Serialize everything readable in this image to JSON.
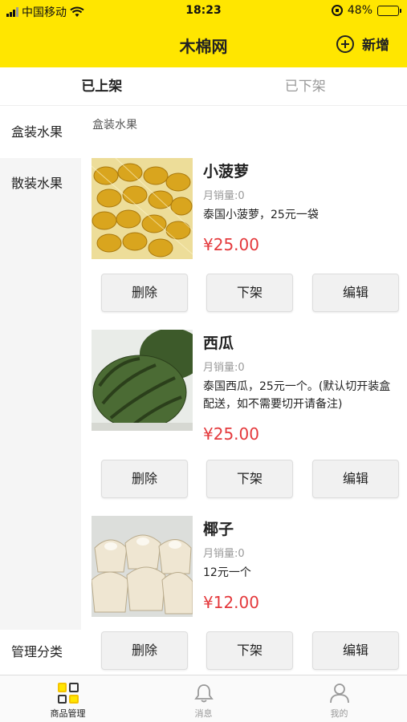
{
  "status": {
    "carrier": "中国移动",
    "time": "18:23",
    "battery": "48%",
    "battery_level": 0.48
  },
  "header": {
    "title": "木棉网",
    "add_label": "新增"
  },
  "tabs": [
    {
      "label": "已上架",
      "active": true
    },
    {
      "label": "已下架",
      "active": false
    }
  ],
  "sidebar": {
    "items": [
      {
        "label": "盒装水果"
      },
      {
        "label": "散装水果"
      }
    ],
    "manage_label": "管理分类"
  },
  "section": {
    "title": "盒装水果"
  },
  "products": [
    {
      "name": "小菠萝",
      "sales": "月销量:0",
      "desc": "泰国小菠萝，25元一袋",
      "price": "¥25.00"
    },
    {
      "name": "西瓜",
      "sales": "月销量:0",
      "desc": "泰国西瓜，25元一个。(默认切开装盒配送，如不需要切开请备注)",
      "price": "¥25.00"
    },
    {
      "name": "椰子",
      "sales": "月销量:0",
      "desc": "12元一个",
      "price": "¥12.00"
    }
  ],
  "actions": {
    "delete": "删除",
    "unlist": "下架",
    "edit": "编辑"
  },
  "tabbar": [
    {
      "label": "商品管理",
      "icon": "grid-icon",
      "active": true
    },
    {
      "label": "消息",
      "icon": "bell-icon",
      "active": false
    },
    {
      "label": "我的",
      "icon": "user-icon",
      "active": false
    }
  ],
  "colors": {
    "brand_yellow": "#ffe600",
    "price_red": "#e4393c"
  }
}
